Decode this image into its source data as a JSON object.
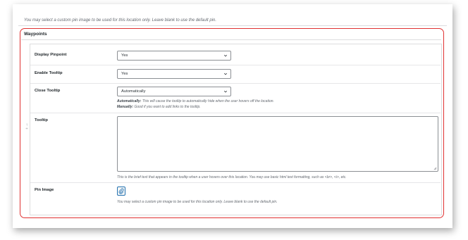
{
  "top_note": "You may select a custom pin image to be used for this location only. Leave blank to use the default pin.",
  "section": {
    "title": "Waypoints"
  },
  "rows": {
    "display_pinpoint": {
      "label": "Display Pinpoint",
      "value": "Yes"
    },
    "enable_tooltip": {
      "label": "Enable Tooltip",
      "value": "Yes"
    },
    "close_tooltip": {
      "label": "Close Tooltip",
      "value": "Automatically",
      "desc1_key": "Automatically:",
      "desc1_text": " This will cause the tooltip to automatically hide when the user hovers off the location.",
      "desc2_key": "Manually:",
      "desc2_text": " Good if you want to add links to the tooltip."
    },
    "tooltip": {
      "label": "Tooltip",
      "value": "",
      "desc": "This is the brief text that appears in the tooltip when a user hovers over this location. You may use basic html text formatting, such as <br>, <i>, etc."
    },
    "pin_image": {
      "label": "Pin Image",
      "desc": "You may select a custom pin image to be used for this location only. Leave blank to use the default pin."
    }
  },
  "icons": {
    "chevron": "chevron-down-icon",
    "drag": "drag-handle-icon",
    "pin": "paperclip-icon"
  },
  "colors": {
    "highlight": "#e03131",
    "accent": "#2271b1",
    "border": "#8c8f94"
  }
}
